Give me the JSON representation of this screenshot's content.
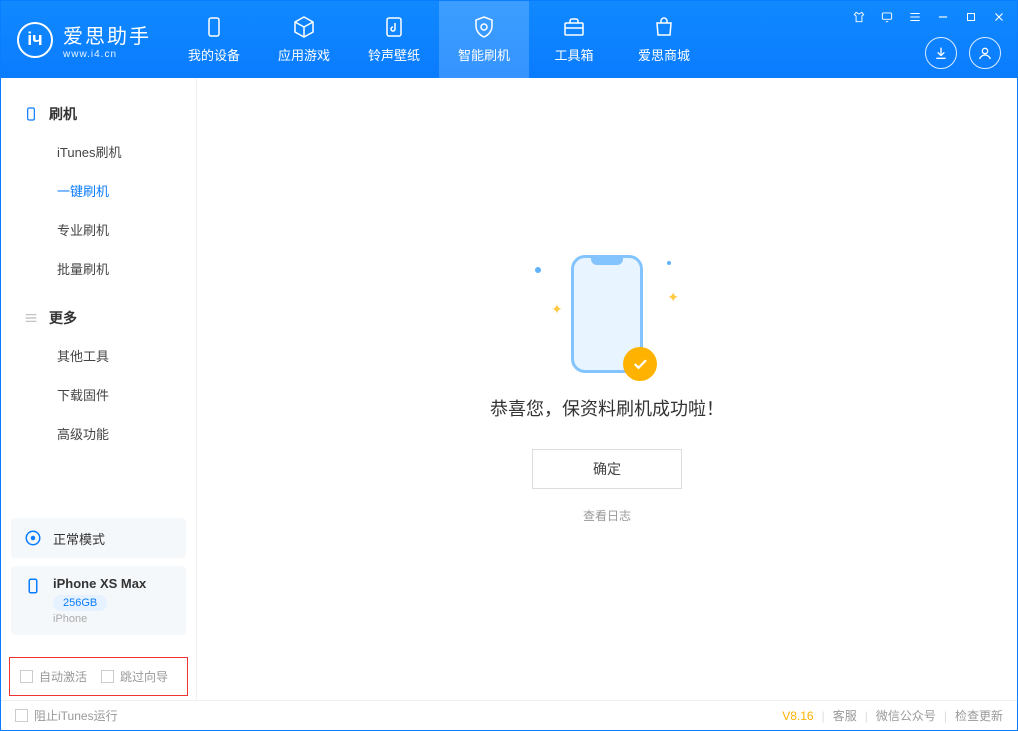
{
  "app": {
    "name": "爱思助手",
    "site": "www.i4.cn"
  },
  "tabs": [
    {
      "label": "我的设备"
    },
    {
      "label": "应用游戏"
    },
    {
      "label": "铃声壁纸"
    },
    {
      "label": "智能刷机"
    },
    {
      "label": "工具箱"
    },
    {
      "label": "爱思商城"
    }
  ],
  "sidebar": {
    "section1": {
      "title": "刷机",
      "items": [
        "iTunes刷机",
        "一键刷机",
        "专业刷机",
        "批量刷机"
      ]
    },
    "section2": {
      "title": "更多",
      "items": [
        "其他工具",
        "下载固件",
        "高级功能"
      ]
    }
  },
  "device_mode": "正常模式",
  "device": {
    "name": "iPhone XS Max",
    "storage": "256GB",
    "type": "iPhone"
  },
  "options": {
    "auto_activate": "自动激活",
    "skip_guide": "跳过向导"
  },
  "main": {
    "message": "恭喜您，保资料刷机成功啦！",
    "ok": "确定",
    "view_log": "查看日志"
  },
  "footer": {
    "stop_itunes": "阻止iTunes运行",
    "version": "V8.16",
    "links": [
      "客服",
      "微信公众号",
      "检查更新"
    ]
  }
}
